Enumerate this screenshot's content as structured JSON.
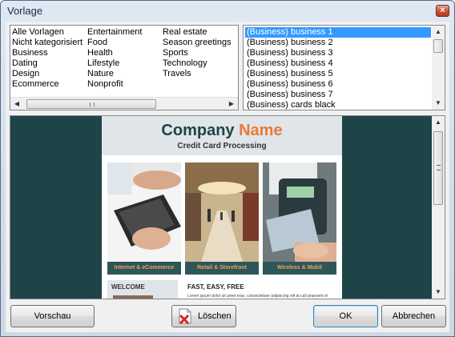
{
  "window": {
    "title": "Vorlage",
    "close_glyph": "×"
  },
  "categories": {
    "col1": [
      "Alle Vorlagen",
      "Nicht kategorisiert",
      "Business",
      "Dating",
      "Design",
      "Ecommerce"
    ],
    "col2": [
      "Entertainment",
      "Food",
      "Health",
      "Lifestyle",
      "Nature",
      "Nonprofit"
    ],
    "col3": [
      "Real estate",
      "Season greetings",
      "Sports",
      "Technology",
      "Travels"
    ]
  },
  "templates": {
    "selected_index": 0,
    "items": [
      "(Business) business 1",
      "(Business) business 2",
      "(Business) business 3",
      "(Business) business 4",
      "(Business) business 5",
      "(Business) business 6",
      "(Business) business 7",
      "(Business) cards black"
    ]
  },
  "preview": {
    "company_first": "Company",
    "company_second": "Name",
    "subtitle": "Credit Card Processing",
    "captions": [
      "Internet & eCommerce",
      "Retail & Storefront",
      "Wireless & Mobil"
    ],
    "welcome": "WELCOME",
    "fast_title": "FAST, EASY, FREE",
    "lorem": "Lorem ipsum dolor sit amet eras, consectetuer adipiscing elit at cali praesent et"
  },
  "buttons": {
    "preview": "Vorschau",
    "delete": "Löschen",
    "ok": "OK",
    "cancel": "Abbrechen"
  },
  "colors": {
    "selection": "#3399ff",
    "preview_bg": "#1f4447",
    "accent_orange": "#e87a3a"
  }
}
